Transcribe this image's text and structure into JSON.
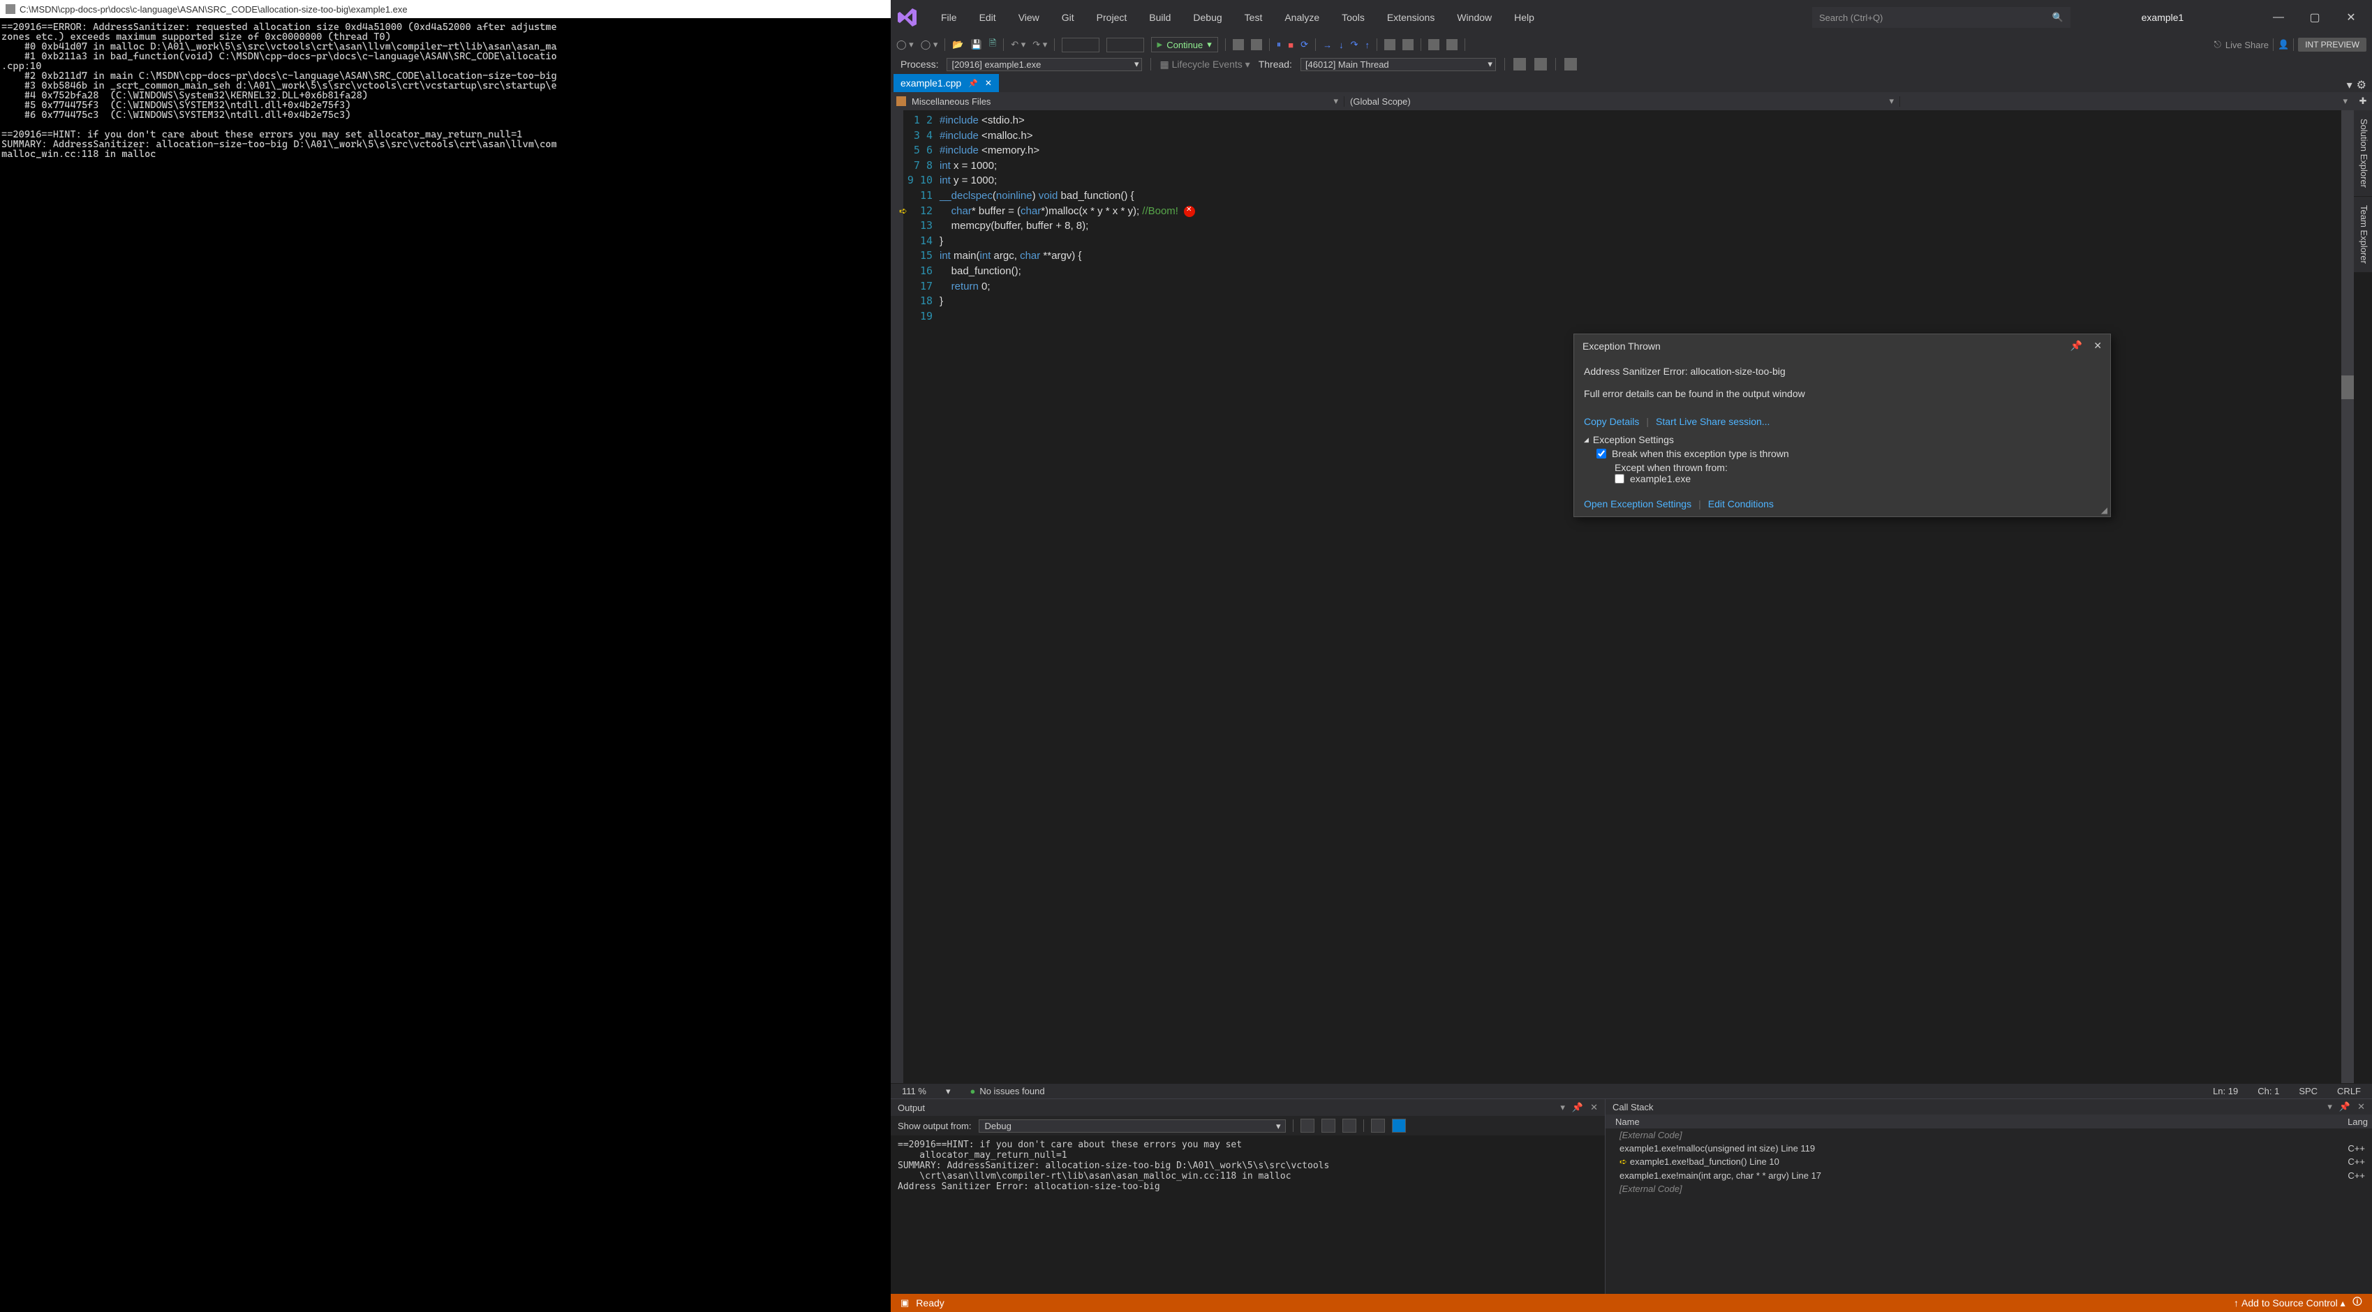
{
  "console": {
    "title": "C:\\MSDN\\cpp-docs-pr\\docs\\c-language\\ASAN\\SRC_CODE\\allocation-size-too-big\\example1.exe",
    "body": "==20916==ERROR: AddressSanitizer: requested allocation size 0xd4a51000 (0xd4a52000 after adjustme\nzones etc.) exceeds maximum supported size of 0xc0000000 (thread T0)\n    #0 0xb41d07 in malloc D:\\A01\\_work\\5\\s\\src\\vctools\\crt\\asan\\llvm\\compiler-rt\\lib\\asan\\asan_ma\n    #1 0xb211a3 in bad_function(void) C:\\MSDN\\cpp-docs-pr\\docs\\c-language\\ASAN\\SRC_CODE\\allocatio\n.cpp:10\n    #2 0xb211d7 in main C:\\MSDN\\cpp-docs-pr\\docs\\c-language\\ASAN\\SRC_CODE\\allocation-size-too-big\n    #3 0xb5846b in _scrt_common_main_seh d:\\A01\\_work\\5\\s\\src\\vctools\\crt\\vcstartup\\src\\startup\\e\n    #4 0x752bfa28  (C:\\WINDOWS\\System32\\KERNEL32.DLL+0x6b81fa28)\n    #5 0x774475f3  (C:\\WINDOWS\\SYSTEM32\\ntdll.dll+0x4b2e75f3)\n    #6 0x774475c3  (C:\\WINDOWS\\SYSTEM32\\ntdll.dll+0x4b2e75c3)\n\n==20916==HINT: if you don't care about these errors you may set allocator_may_return_null=1\nSUMMARY: AddressSanitizer: allocation-size-too-big D:\\A01\\_work\\5\\s\\src\\vctools\\crt\\asan\\llvm\\com\nmalloc_win.cc:118 in malloc"
  },
  "vs": {
    "menus": [
      "File",
      "Edit",
      "View",
      "Git",
      "Project",
      "Build",
      "Debug",
      "Test",
      "Analyze",
      "Tools",
      "Extensions",
      "Window",
      "Help"
    ],
    "search_placeholder": "Search (Ctrl+Q)",
    "solution": "example1",
    "preview": "INT PREVIEW",
    "live_share": "Live Share",
    "continue_label": "Continue",
    "process": {
      "label": "Process:",
      "value": "[20916] example1.exe",
      "lifecycle": "Lifecycle Events",
      "thread_label": "Thread:",
      "thread_value": "[46012] Main Thread"
    },
    "tab": {
      "name": "example1.cpp"
    },
    "scope": {
      "left": "Miscellaneous Files",
      "right": "(Global Scope)"
    },
    "side_tabs": [
      "Solution Explorer",
      "Team Explorer"
    ],
    "editor_status": {
      "zoom": "111 %",
      "issues": "No issues found",
      "ln": "Ln: 19",
      "ch": "Ch: 1",
      "spc": "SPC",
      "crlf": "CRLF"
    },
    "exception": {
      "title": "Exception Thrown",
      "message": "Address Sanitizer Error: allocation-size-too-big",
      "subtext": "Full error details can be found in the output window",
      "copy": "Copy Details",
      "share": "Start Live Share session...",
      "settings_header": "Exception Settings",
      "break_label": "Break when this exception type is thrown",
      "except_label": "Except when thrown from:",
      "exe": "example1.exe",
      "open_settings": "Open Exception Settings",
      "edit_cond": "Edit Conditions"
    },
    "output": {
      "title": "Output",
      "show_from": "Show output from:",
      "source": "Debug",
      "body": "==20916==HINT: if you don't care about these errors you may set\n    allocator_may_return_null=1\nSUMMARY: AddressSanitizer: allocation-size-too-big D:\\A01\\_work\\5\\s\\src\\vctools\n    \\crt\\asan\\llvm\\compiler-rt\\lib\\asan\\asan_malloc_win.cc:118 in malloc\nAddress Sanitizer Error: allocation-size-too-big"
    },
    "callstack": {
      "title": "Call Stack",
      "col_name": "Name",
      "col_lang": "Lang",
      "rows": [
        {
          "name": "[External Code]",
          "lang": "",
          "ext": true,
          "cur": false
        },
        {
          "name": "example1.exe!malloc(unsigned int size) Line 119",
          "lang": "C++",
          "ext": false,
          "cur": false
        },
        {
          "name": "example1.exe!bad_function() Line 10",
          "lang": "C++",
          "ext": false,
          "cur": true
        },
        {
          "name": "example1.exe!main(int argc, char * * argv) Line 17",
          "lang": "C++",
          "ext": false,
          "cur": false
        },
        {
          "name": "[External Code]",
          "lang": "",
          "ext": true,
          "cur": false
        }
      ]
    },
    "statusbar": {
      "ready": "Ready",
      "add_source": "Add to Source Control"
    }
  },
  "code_lines": [
    "#include <stdio.h>",
    "#include <malloc.h>",
    "#include <memory.h>",
    "",
    "int x = 1000;",
    "int y = 1000;",
    "",
    "__declspec(noinline) void bad_function() {",
    "",
    "    char* buffer = (char*)malloc(x * y * x * y); //Boom!",
    "",
    "    memcpy(buffer, buffer + 8, 8);",
    "}",
    "",
    "int main(int argc, char **argv) {",
    "    bad_function();",
    "    return 0;",
    "}",
    ""
  ]
}
